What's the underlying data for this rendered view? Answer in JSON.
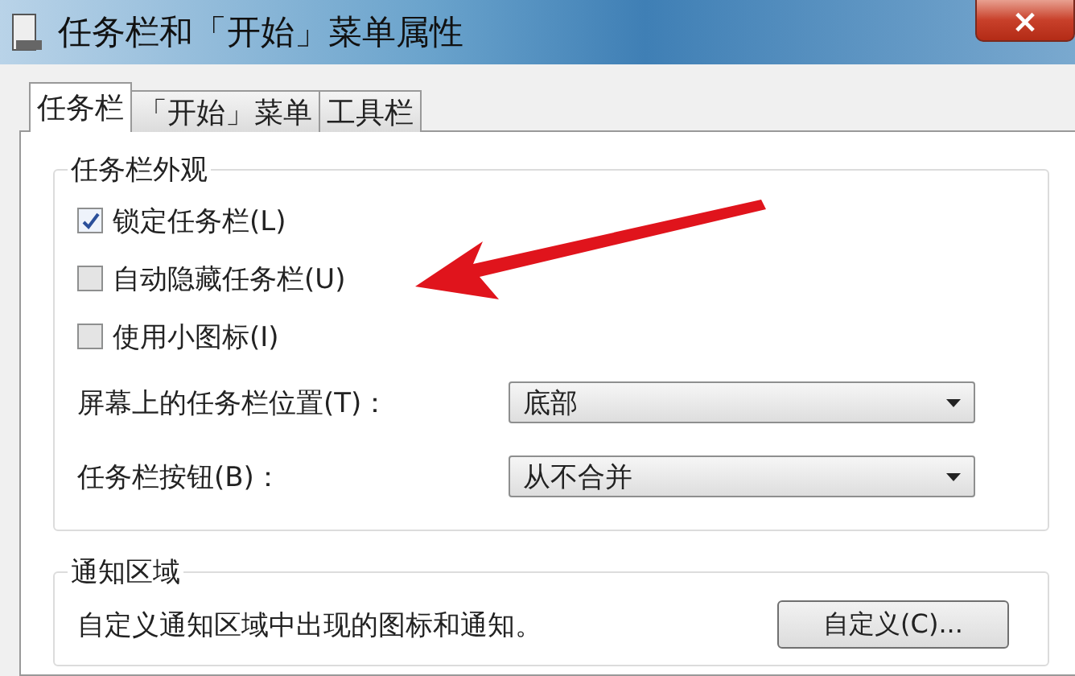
{
  "window": {
    "title": "任务栏和「开始」菜单属性",
    "close": "×"
  },
  "tabs": [
    {
      "label": "任务栏",
      "selected": true
    },
    {
      "label": "「开始」菜单",
      "selected": false
    },
    {
      "label": "工具栏",
      "selected": false
    }
  ],
  "appearance": {
    "title": "任务栏外观",
    "checkboxes": [
      {
        "label": "锁定任务栏(L)",
        "checked": true
      },
      {
        "label": "自动隐藏任务栏(U)",
        "checked": false
      },
      {
        "label": "使用小图标(I)",
        "checked": false
      }
    ],
    "dropdowns": [
      {
        "label": "屏幕上的任务栏位置(T)：",
        "value": "底部"
      },
      {
        "label": "任务栏按钮(B)：",
        "value": "从不合并"
      }
    ]
  },
  "notification": {
    "title": "通知区域",
    "text": "自定义通知区域中出现的图标和通知。",
    "button": "自定义(C)..."
  }
}
